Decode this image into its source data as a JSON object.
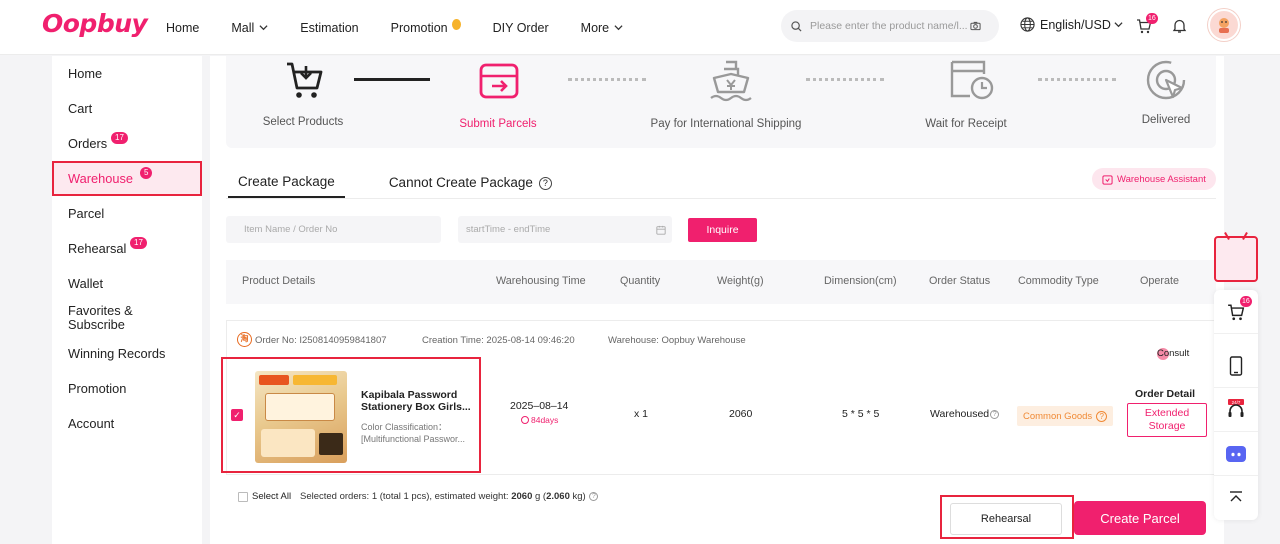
{
  "brand": {
    "logo": "Oopbuy",
    "accent": "#f0206e",
    "highlight": "#e8243e"
  },
  "header": {
    "nav": [
      {
        "label": "Home",
        "dropdown": false
      },
      {
        "label": "Mall",
        "dropdown": true
      },
      {
        "label": "Estimation",
        "dropdown": false
      },
      {
        "label": "Promotion",
        "dropdown": false,
        "coin": true
      },
      {
        "label": "DIY Order",
        "dropdown": false
      },
      {
        "label": "More",
        "dropdown": true
      }
    ],
    "search_placeholder": "Please enter the product name/l...",
    "language": "English/USD",
    "cart_badge": "16"
  },
  "sidebar": {
    "items": [
      {
        "label": "Home",
        "badge": ""
      },
      {
        "label": "Cart",
        "badge": ""
      },
      {
        "label": "Orders",
        "badge": "17"
      },
      {
        "label": "Warehouse",
        "badge": "5",
        "active": true
      },
      {
        "label": "Parcel",
        "badge": ""
      },
      {
        "label": "Rehearsal",
        "badge": "17"
      },
      {
        "label": "Wallet",
        "badge": ""
      },
      {
        "label": "Favorites &\nSubscribe",
        "badge": ""
      },
      {
        "label": "Winning Records",
        "badge": ""
      },
      {
        "label": "Promotion",
        "badge": ""
      },
      {
        "label": "Account",
        "badge": ""
      }
    ]
  },
  "steps": [
    {
      "label": "Select Products",
      "icon": "cart-icon",
      "active": false
    },
    {
      "label": "Submit Parcels",
      "icon": "parcel-icon",
      "active": true
    },
    {
      "label": "Pay for International Shipping",
      "icon": "ship-icon",
      "active": false
    },
    {
      "label": "Wait for Receipt",
      "icon": "calendar-clock-icon",
      "active": false
    },
    {
      "label": "Delivered",
      "icon": "location-pointer-icon",
      "active": false
    }
  ],
  "tabs": {
    "create": "Create Package",
    "cannot": "Cannot Create Package",
    "help": "?"
  },
  "warehouse_assistant": "Warehouse Assistant",
  "filters": {
    "item_placeholder": "Item Name / Order No",
    "date_placeholder": "startTime - endTime",
    "inquire": "Inquire"
  },
  "table": {
    "headers": [
      "Product Details",
      "Warehousing Time",
      "Quantity",
      "Weight(g)",
      "Dimension(cm)",
      "Order Status",
      "Commodity Type",
      "Operate"
    ]
  },
  "order": {
    "shop_glyph": "淘",
    "order_no": "Order No:  I2508140959841807",
    "creation_time": "Creation Time: 2025-08-14 09:46:20",
    "warehouse": "Warehouse: Oopbuy Warehouse",
    "consult": "Consult",
    "product": {
      "name_line1": "Kapibala Password",
      "name_line2": "Stationery Box Girls...",
      "attr_line1": "Color Classification：",
      "attr_line2": "[Multifunctional Passwor..."
    },
    "warehousing_date": "2025–08–14",
    "warehousing_days": "84days",
    "quantity": "x 1",
    "weight": "2060",
    "dimension": "5 * 5 * 5",
    "status": "Warehoused",
    "commodity_type": "Common Goods",
    "order_detail": "Order Detail",
    "extended_storage": "Extended\nStorage"
  },
  "footer": {
    "select_all": "Select All",
    "selected_prefix": "Selected orders: 1 (total 1 pcs), estimated weight: ",
    "weight_g": "2060",
    "unit_g": " g (",
    "weight_kg": "2.060",
    "unit_kg": " kg)",
    "rehearsal": "Rehearsal",
    "create_parcel": "Create Parcel"
  },
  "rail": {
    "cart_badge": "16",
    "support_badge": "24/7"
  }
}
